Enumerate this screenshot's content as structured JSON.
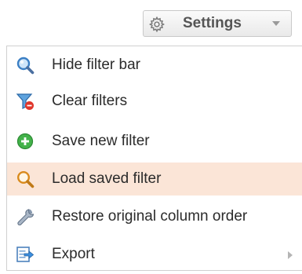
{
  "settings_button": {
    "label": "Settings",
    "icon": "gear-icon",
    "caret_icon": "caret-down-icon"
  },
  "menu": {
    "items": [
      {
        "label": "Hide filter bar",
        "icon": "magnifier-icon"
      },
      {
        "label": "Clear filters",
        "icon": "filter-clear-icon"
      },
      {
        "label": "Save new filter",
        "icon": "plus-circle-icon"
      },
      {
        "label": "Load saved filter",
        "icon": "search-icon",
        "highlighted": true
      },
      {
        "label": "Restore original column order",
        "icon": "wrench-icon"
      },
      {
        "label": "Export",
        "icon": "export-icon",
        "submenu": true,
        "submenu_icon": "chevron-right-icon"
      }
    ]
  },
  "colors": {
    "highlight": "#fbe5d7",
    "text": "#2b2b2b",
    "button_text": "#555555"
  }
}
